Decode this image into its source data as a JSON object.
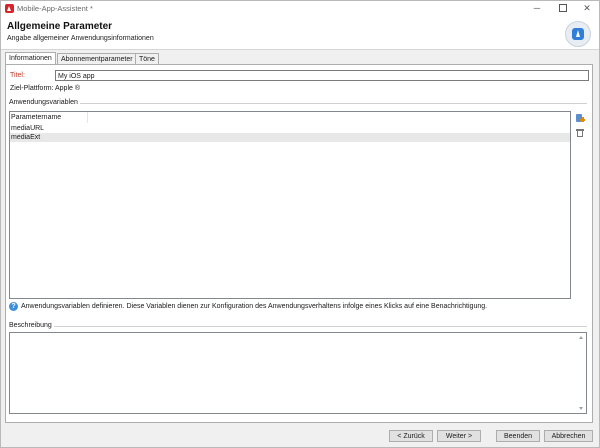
{
  "window": {
    "title": "Mobile-App-Assistent *"
  },
  "header": {
    "title": "Allgemeine Parameter",
    "subtitle": "Angabe allgemeiner Anwendungsinformationen"
  },
  "tabs": [
    {
      "label": "Informationen"
    },
    {
      "label": "Abonnementparameter"
    },
    {
      "label": "Töne"
    }
  ],
  "form": {
    "title_label": "Titel:",
    "title_value": "My iOS app",
    "platform_label": "Ziel-Plattform:",
    "platform_value": "Apple ®"
  },
  "variables": {
    "group_label": "Anwendungsvariablen",
    "column_header": "Parametername",
    "rows": [
      {
        "name": "mediaURL"
      },
      {
        "name": "mediaExt"
      }
    ],
    "info": "Anwendungsvariablen definieren. Diese Variablen dienen zur Konfiguration des Anwendungsverhaltens infolge eines Klicks auf eine Benachrichtigung."
  },
  "description": {
    "group_label": "Beschreibung",
    "value": ""
  },
  "buttons": {
    "back": "< Zurück",
    "next": "Weiter >",
    "finish": "Beenden",
    "cancel": "Abbrechen"
  },
  "icons": {
    "app": "adobe-campaign-icon",
    "wizard": "mobile-app-icon",
    "add": "add-variable-icon",
    "delete": "trash-icon",
    "info": "info-icon"
  },
  "colors": {
    "required_label": "#c0392b",
    "info": "#3d8fdb",
    "selected_row": "#e8e8e8"
  }
}
